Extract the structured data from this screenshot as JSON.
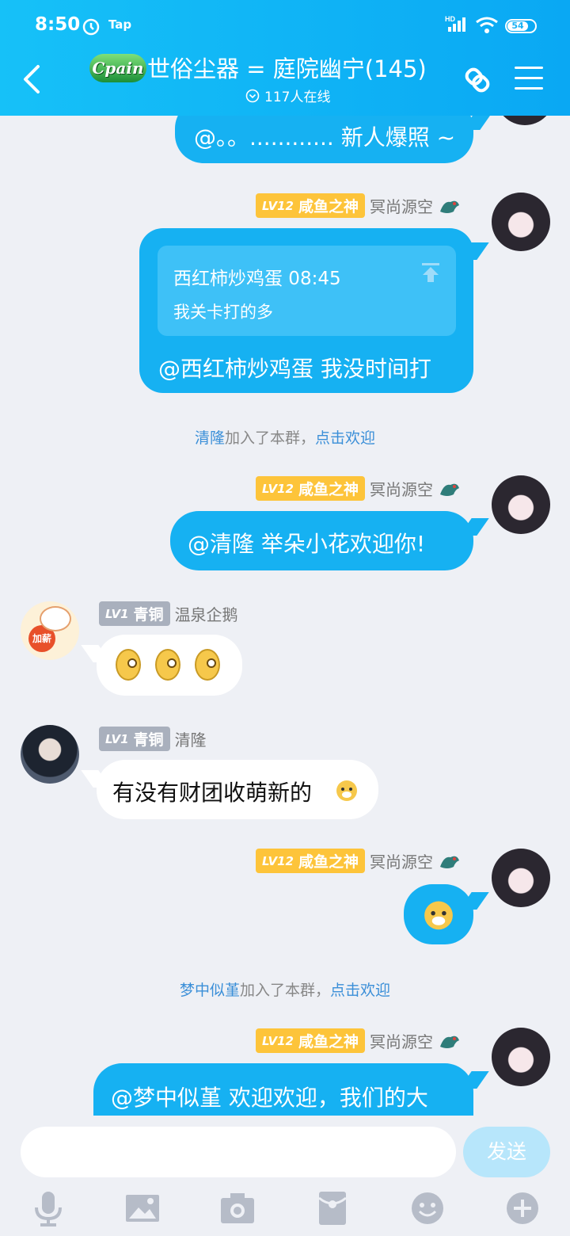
{
  "status_bar": {
    "time": "8:50",
    "tap_label": "Tap",
    "signal_label": "HD",
    "battery": "54"
  },
  "header": {
    "logo_text": "Cpain",
    "title": "世俗尘器 = 庭院幽宁(145)",
    "online": "117人在线"
  },
  "messages": [
    {
      "text": "@。。............ 新人爆照 ~"
    },
    {
      "badge_level": "LV12",
      "badge_title": "咸鱼之神",
      "sender": "冥尚源空",
      "quote_header": "西红柿炒鸡蛋 08:45",
      "quote_body": "我关卡打的多",
      "text": "@西红柿炒鸡蛋 我没时间打"
    },
    {
      "badge_level": "LV12",
      "badge_title": "咸鱼之神",
      "sender": "冥尚源空",
      "text": "@清隆 举朵小花欢迎你!"
    },
    {
      "badge_level": "LV1",
      "badge_title": "青铜",
      "sender": "温泉企鹅",
      "avatar_text": "加薪"
    },
    {
      "badge_level": "LV1",
      "badge_title": "青铜",
      "sender": "清隆",
      "text": "有没有财团收萌新的"
    },
    {
      "badge_level": "LV12",
      "badge_title": "咸鱼之神",
      "sender": "冥尚源空"
    },
    {
      "badge_level": "LV12",
      "badge_title": "咸鱼之神",
      "sender": "冥尚源空",
      "text": "@梦中似堇 欢迎欢迎，我们的大"
    }
  ],
  "notices": [
    {
      "name": "清隆",
      "middle": "加入了本群，",
      "action": "点击欢迎"
    },
    {
      "name": "梦中似堇",
      "middle": "加入了本群，",
      "action": "点击欢迎"
    }
  ],
  "footer": {
    "send_label": "发送"
  },
  "icons": [
    "back-arrow-icon",
    "alarm-icon",
    "wifi-icon",
    "signal-icon",
    "battery-icon",
    "share-link-icon",
    "menu-icon",
    "mic-icon",
    "image-icon",
    "camera-icon",
    "red-packet-icon",
    "emoji-icon",
    "plus-icon"
  ],
  "colors": {
    "header": "#16b7f5",
    "bubble_self": "#16b1f2",
    "bubble_other": "#ffffff",
    "badge_gold": "#fdc43a",
    "badge_gray": "#a9b0bd",
    "link": "#3b8fd8",
    "send_disabled": "#b7e6fb"
  }
}
